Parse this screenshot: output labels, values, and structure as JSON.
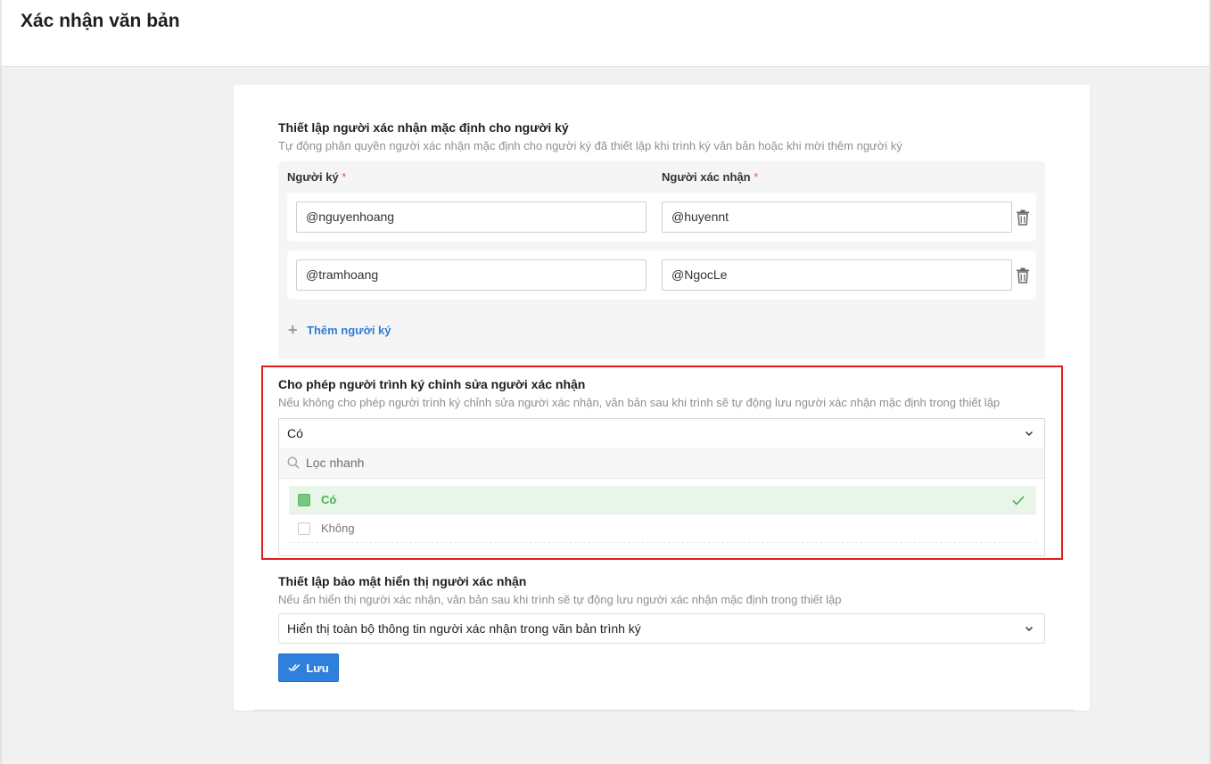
{
  "page": {
    "title": "Xác nhận văn bản"
  },
  "section1": {
    "title": "Thiết lập người xác nhận mặc định cho người ký",
    "description": "Tự động phân quyền người xác nhận mặc định cho người ký đã thiết lập khi trình ký văn bản hoặc khi mời thêm người ký",
    "col_signer": "Người ký",
    "col_confirmer": "Người xác nhận",
    "required_mark": "*",
    "rows": [
      {
        "signer": "@nguyenhoang",
        "confirmer": "@huyennt"
      },
      {
        "signer": "@tramhoang",
        "confirmer": "@NgocLe"
      }
    ],
    "add_label": "Thêm người ký",
    "add_icon": "+"
  },
  "section2": {
    "title": "Cho phép người trình ký chỉnh sửa người xác nhận",
    "description": "Nếu không cho phép người trình ký chỉnh sửa người xác nhận, văn bản sau khi trình sẽ tự động lưu người xác nhận mặc định trong thiết lập",
    "selected_value": "Có",
    "filter_placeholder": "Lọc nhanh",
    "options": [
      {
        "label": "Có",
        "selected": true
      },
      {
        "label": "Không",
        "selected": false
      }
    ]
  },
  "section3": {
    "title": "Thiết lập bảo mật hiển thị người xác nhận",
    "description": "Nếu ẩn hiển thị người xác nhận, văn bản sau khi trình sẽ tự động lưu người xác nhận mặc định trong thiết lập",
    "selected_value": "Hiển thị toàn bộ thông tin người xác nhận trong văn bản trình ký"
  },
  "actions": {
    "save_label": "Lưu"
  },
  "colors": {
    "accent": "#2f80dc",
    "highlight_border": "#e01d1d",
    "selected_green": "#4caf50",
    "selected_bg": "#e8f5e9",
    "required": "#e55353"
  },
  "icons": {
    "trash": "trash-icon",
    "chevron": "chevron-down-icon",
    "search": "search-icon",
    "check": "check-icon",
    "save": "double-check-icon"
  }
}
